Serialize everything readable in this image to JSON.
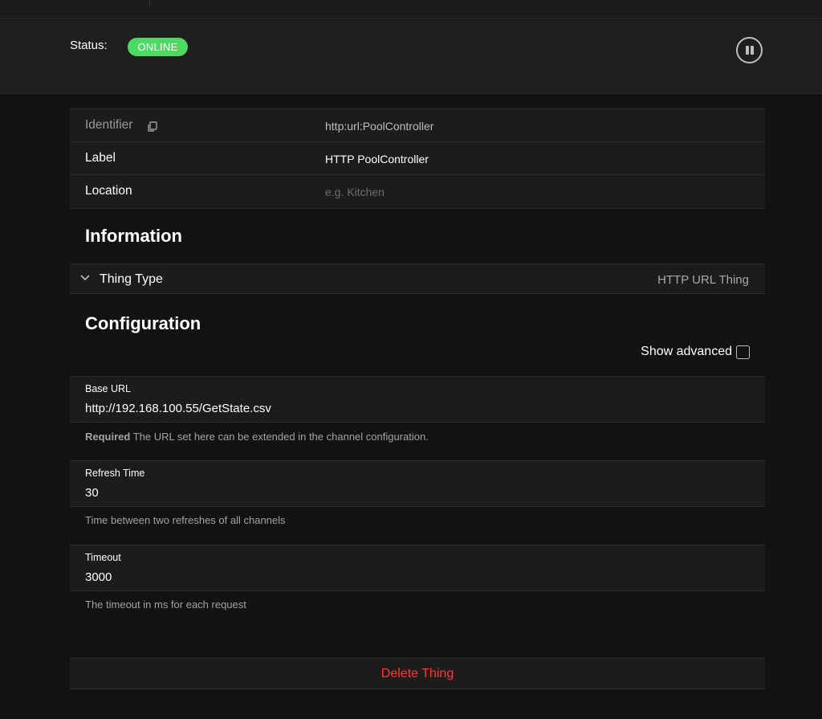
{
  "status": {
    "label": "Status:",
    "badge": "ONLINE",
    "badge_color": "#4cd964"
  },
  "properties": {
    "identifier_label": "Identifier",
    "identifier_value": "http:url:PoolController",
    "label_label": "Label",
    "label_value": "HTTP PoolController",
    "location_label": "Location",
    "location_placeholder": "e.g. Kitchen"
  },
  "information": {
    "title": "Information",
    "thing_type_label": "Thing Type",
    "thing_type_value": "HTTP URL Thing"
  },
  "configuration": {
    "title": "Configuration",
    "show_advanced_label": "Show advanced",
    "show_advanced_checked": false,
    "fields": [
      {
        "label": "Base URL",
        "value": "http://192.168.100.55/GetState.csv",
        "help_required": "Required",
        "help": "The URL set here can be extended in the channel configuration."
      },
      {
        "label": "Refresh Time",
        "value": "30",
        "help": "Time between two refreshes of all channels"
      },
      {
        "label": "Timeout",
        "value": "3000",
        "help": "The timeout in ms for each request"
      }
    ]
  },
  "actions": {
    "delete_label": "Delete Thing",
    "delete_color": "#ff3b30"
  },
  "icons": {
    "copy": "copy-icon",
    "pause": "pause-icon",
    "chevron": "chevron-down-icon"
  }
}
